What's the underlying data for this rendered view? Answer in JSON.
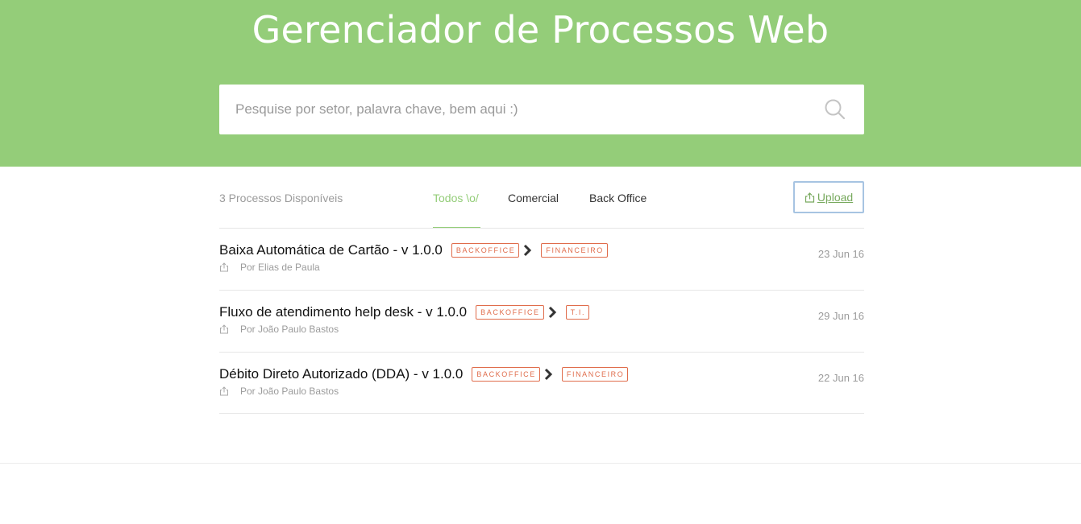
{
  "header": {
    "title": "Gerenciador de Processos Web",
    "search_placeholder": "Pesquise por setor, palavra chave, bem aqui :)",
    "search_icon": "search-icon",
    "background_color": "#94cd79"
  },
  "toolbar": {
    "count_label": "3 Processos Disponíveis",
    "tabs": [
      {
        "label": "Todos \\o/",
        "active": true
      },
      {
        "label": "Comercial",
        "active": false
      },
      {
        "label": "Back Office",
        "active": false
      }
    ],
    "upload_label": "Upload",
    "upload_icon": "share-icon",
    "accent_color": "#94cd79"
  },
  "processes": [
    {
      "title": "Baixa Automática de Cartão - v 1.0.0",
      "tags": [
        "BACKOFFICE",
        "FINANCEIRO"
      ],
      "author": "Por Elias de Paula",
      "date": "23 Jun 16"
    },
    {
      "title": "Fluxo de atendimento help desk - v 1.0.0",
      "tags": [
        "BACKOFFICE",
        "T.I."
      ],
      "author": "Por João Paulo Bastos",
      "date": "29 Jun 16"
    },
    {
      "title": "Débito Direto Autorizado (DDA) - v 1.0.0",
      "tags": [
        "BACKOFFICE",
        "FINANCEIRO"
      ],
      "author": "Por João Paulo Bastos",
      "date": "22 Jun 16"
    }
  ],
  "tag_color": "#e06c4b"
}
